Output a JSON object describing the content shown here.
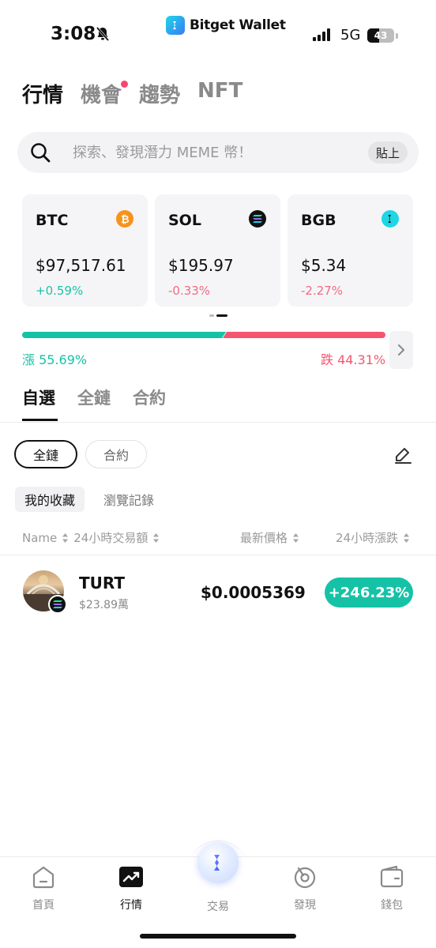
{
  "status_bar": {
    "time": "3:08",
    "brand": "Bitget Wallet",
    "network": "5G",
    "battery": "43",
    "battery_level": 0.43
  },
  "top_tabs": [
    {
      "label": "行情",
      "active": true
    },
    {
      "label": "機會",
      "badge": true
    },
    {
      "label": "趨勢"
    },
    {
      "label": "NFT"
    }
  ],
  "search": {
    "placeholder": "探索、發現潛力 MEME 幣！",
    "paste_label": "貼上"
  },
  "coin_cards": [
    {
      "symbol": "BTC",
      "price": "$97,517.61",
      "change": "+0.59%",
      "direction": "up",
      "icon": "bitcoin-icon",
      "icon_color": "#f7931a"
    },
    {
      "symbol": "SOL",
      "price": "$195.97",
      "change": "-0.33%",
      "direction": "down",
      "icon": "solana-icon",
      "icon_color": "#111111"
    },
    {
      "symbol": "BGB",
      "price": "$5.34",
      "change": "-2.27%",
      "direction": "down",
      "icon": "bitget-icon",
      "icon_color": "#1fd6e5"
    }
  ],
  "market_ratio": {
    "up_label": "漲 55.69%",
    "down_label": "跌 44.31%",
    "up_fraction": 0.5569
  },
  "sub_tabs": [
    {
      "label": "自選",
      "active": true
    },
    {
      "label": "全鏈"
    },
    {
      "label": "合約"
    }
  ],
  "chips": [
    {
      "label": "全鏈",
      "active": true
    },
    {
      "label": "合約"
    }
  ],
  "filters": [
    {
      "label": "我的收藏",
      "active": true
    },
    {
      "label": "瀏覽記錄"
    }
  ],
  "list_header": {
    "name": "Name",
    "volume": "24小時交易額",
    "price": "最新價格",
    "change": "24小時漲跌"
  },
  "tokens": [
    {
      "name": "TURT",
      "volume": "$23.89萬",
      "price": "$0.0005369",
      "change": "+246.23%"
    }
  ],
  "bottom_nav": [
    {
      "label": "首頁",
      "icon": "home-icon"
    },
    {
      "label": "行情",
      "icon": "market-icon",
      "active": true
    },
    {
      "label": "交易",
      "icon": "trade-icon"
    },
    {
      "label": "發現",
      "icon": "discover-icon"
    },
    {
      "label": "錢包",
      "icon": "wallet-icon"
    }
  ],
  "colors": {
    "up": "#16c2a6",
    "down": "#f5566f",
    "accent_badge": "#f5486c"
  }
}
